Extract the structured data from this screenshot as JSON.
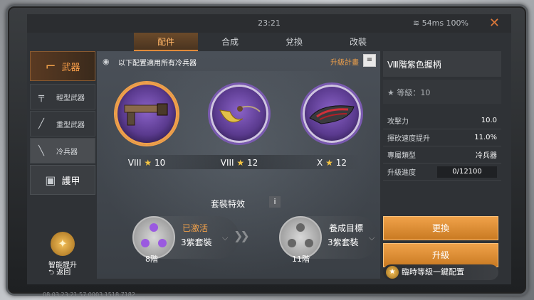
{
  "status": {
    "time": "23:21",
    "network": "54ms 100%"
  },
  "tabs": [
    {
      "label": "配件",
      "active": true
    },
    {
      "label": "合成",
      "active": false
    },
    {
      "label": "兌換",
      "active": false
    },
    {
      "label": "改裝",
      "active": false
    }
  ],
  "sidebar": {
    "weapons_label": "武器",
    "light_label": "輕型武器",
    "heavy_label": "重型武器",
    "melee_label": "冷兵器",
    "armor_label": "護甲",
    "smart_label": "智能提升",
    "back_label": "返回"
  },
  "main": {
    "note": "以下配置適用所有冷兵器",
    "upgrade_plan": "升級計畫",
    "items": [
      {
        "grade": "VIII",
        "level": "10"
      },
      {
        "grade": "VIII",
        "level": "12"
      },
      {
        "grade": "X",
        "level": "12"
      }
    ],
    "set_title": "套裝特效",
    "set_active": {
      "status": "已激活",
      "sub": "3紫套裝",
      "level": "8階"
    },
    "set_target": {
      "status": "養成目標",
      "sub": "3紫套裝",
      "level": "11階"
    }
  },
  "right": {
    "title": "Ⅷ階紫色握柄",
    "grade": "等級：10",
    "stats": [
      {
        "label": "攻擊力",
        "value": "10.0"
      },
      {
        "label": "揮砍速度提升",
        "value": "11.0%"
      },
      {
        "label": "專屬類型",
        "value": "冷兵器"
      }
    ],
    "progress_label": "升級進度",
    "progress_value": "0/12100",
    "replace_label": "更換",
    "upgrade_label": "升級",
    "oneclick_label": "臨時等級一鍵配置"
  },
  "footer": "08 03 23:21 57 0003 1518 7182",
  "colors": {
    "accent": "#f0a24a",
    "purple": "#5a3a8e"
  }
}
